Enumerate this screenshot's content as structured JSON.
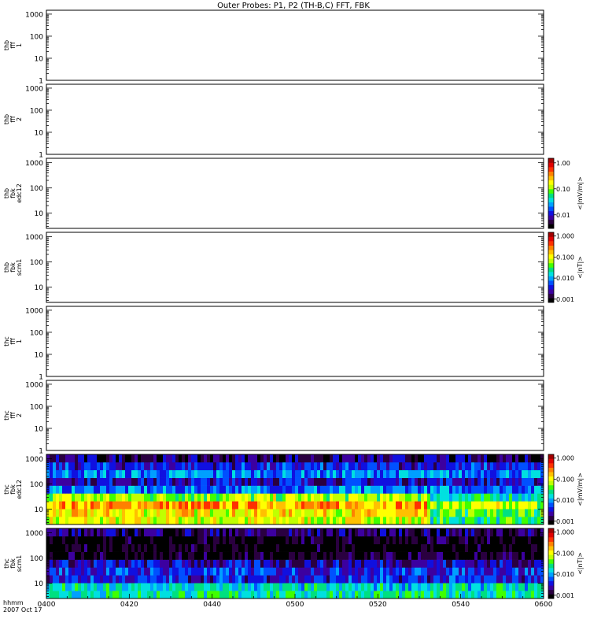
{
  "chart_data": {
    "type": "heatmap",
    "title": "Outer Probes: P1, P2 (TH-B,C) FFT, FBK",
    "x_axis": {
      "range": [
        "0400",
        "0600"
      ],
      "tick_labels": [
        "0400",
        "0420",
        "0440",
        "0500",
        "0520",
        "0540",
        "0600"
      ],
      "left_label_line1": "hhmm",
      "left_label_line2": "2007 Oct 17"
    },
    "y_scale": "log",
    "y_tick_labels": [
      "1",
      "10",
      "100",
      "1000"
    ],
    "panels": [
      {
        "id": "thb-fff-1",
        "label_lines": [
          "thb",
          "fff",
          "1"
        ],
        "ylim": [
          1,
          1500
        ],
        "ticks": [
          1,
          10,
          100,
          1000
        ],
        "has_data": false,
        "colorbar": null
      },
      {
        "id": "thb-fff-2",
        "label_lines": [
          "thb",
          "fff",
          "2"
        ],
        "ylim": [
          1,
          1500
        ],
        "ticks": [
          1,
          10,
          100,
          1000
        ],
        "has_data": false,
        "colorbar": null
      },
      {
        "id": "thb-fbk-edc12",
        "label_lines": [
          "thb",
          "fbk",
          "edc12"
        ],
        "ylim": [
          2.5,
          1500
        ],
        "ticks": [
          10,
          100,
          1000
        ],
        "has_data": false,
        "colorbar": {
          "label": "<|mV/m|>",
          "range": [
            0.003,
            1.5
          ],
          "tick_labels": [
            "0.01",
            "0.10",
            "1.00"
          ],
          "tick_values": [
            0.01,
            0.1,
            1.0
          ]
        }
      },
      {
        "id": "thb-fbk-scm1",
        "label_lines": [
          "thb",
          "fbk",
          "scm1"
        ],
        "ylim": [
          2.5,
          1500
        ],
        "ticks": [
          10,
          100,
          1000
        ],
        "has_data": false,
        "colorbar": {
          "label": "<|nT|>",
          "range": [
            0.0007,
            1.5
          ],
          "tick_labels": [
            "0.001",
            "0.010",
            "0.100",
            "1.000"
          ],
          "tick_values": [
            0.001,
            0.01,
            0.1,
            1.0
          ]
        }
      },
      {
        "id": "thc-fff-1",
        "label_lines": [
          "thc",
          "fff",
          "1"
        ],
        "ylim": [
          1,
          1500
        ],
        "ticks": [
          1,
          10,
          100,
          1000
        ],
        "has_data": false,
        "colorbar": null
      },
      {
        "id": "thc-fff-2",
        "label_lines": [
          "thc",
          "fff",
          "2"
        ],
        "ylim": [
          1,
          1500
        ],
        "ticks": [
          1,
          10,
          100,
          1000
        ],
        "has_data": false,
        "colorbar": null
      },
      {
        "id": "thc-fbk-edc12",
        "label_lines": [
          "thc",
          "fbk",
          "edc12"
        ],
        "ylim": [
          2.5,
          1500
        ],
        "ticks": [
          10,
          100,
          1000
        ],
        "has_data": true,
        "colorbar": {
          "label": "<|mV/m|>",
          "range": [
            0.0007,
            1.5
          ],
          "tick_labels": [
            "0.001",
            "0.010",
            "0.100",
            "1.000"
          ],
          "tick_values": [
            0.001,
            0.01,
            0.1,
            1.0
          ]
        },
        "band_levels": [
          0.62,
          0.66,
          0.75,
          0.58,
          0.3,
          0.2,
          0.32,
          0.22,
          0.12
        ]
      },
      {
        "id": "thc-fbk-scm1",
        "label_lines": [
          "thc",
          "fbk",
          "scm1"
        ],
        "ylim": [
          2.5,
          1500
        ],
        "ticks": [
          10,
          100,
          1000
        ],
        "has_data": true,
        "colorbar": {
          "label": "<|nT|>",
          "range": [
            0.0007,
            1.5
          ],
          "tick_labels": [
            "0.001",
            "0.010",
            "0.100",
            "1.000"
          ],
          "tick_values": [
            0.001,
            0.01,
            0.1,
            1.0
          ]
        },
        "band_levels": [
          0.45,
          0.4,
          0.22,
          0.24,
          0.18,
          0.04,
          0.02,
          0.03,
          0.12
        ]
      }
    ],
    "colormap": [
      "#000000",
      "#2a0040",
      "#3c00a0",
      "#1010e0",
      "#0050ff",
      "#00a0ff",
      "#00e0e0",
      "#00e080",
      "#40ff00",
      "#c0ff00",
      "#ffff00",
      "#ffc000",
      "#ff8000",
      "#ff3000",
      "#e00000",
      "#a00000"
    ]
  }
}
